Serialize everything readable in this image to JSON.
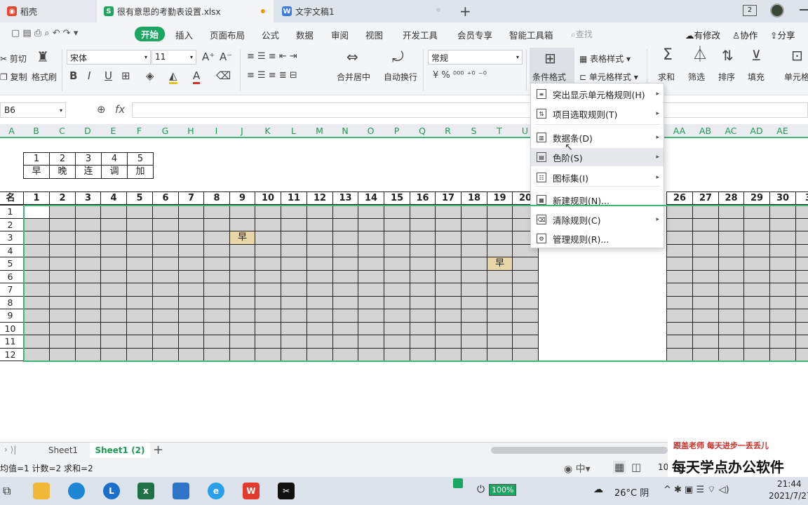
{
  "tabs": [
    {
      "label": "稻壳"
    },
    {
      "label": "很有意思的考勤表设置.xlsx"
    },
    {
      "label": "文字文稿1"
    }
  ],
  "window": {
    "badge": "2"
  },
  "menu": [
    "开始",
    "插入",
    "页面布局",
    "公式",
    "数据",
    "审阅",
    "视图",
    "开发工具",
    "会员专享",
    "智能工具箱"
  ],
  "menu_right": {
    "search": "查找",
    "modify": "有修改",
    "collab": "协作",
    "share": "分享"
  },
  "ribbon": {
    "cut": "剪切",
    "copy": "复制",
    "format_painter": "格式刷",
    "font_name": "宋体",
    "font_size": "11",
    "merge": "合并居中",
    "wrap": "自动换行",
    "number_format": "常规",
    "cond_format": "条件格式",
    "table_style": "表格样式",
    "cell_style": "单元格样式",
    "sum": "求和",
    "filter": "筛选",
    "sort": "排序",
    "fill": "填充",
    "cell_ops": "单元格"
  },
  "formula": {
    "name_box": "B6",
    "fx": "fx",
    "value": ""
  },
  "columns": [
    "A",
    "B",
    "C",
    "D",
    "E",
    "F",
    "G",
    "H",
    "I",
    "J",
    "K",
    "L",
    "M",
    "N",
    "O",
    "P",
    "Q",
    "R",
    "S",
    "T",
    "U",
    "AA",
    "AB",
    "AC",
    "AD",
    "AE"
  ],
  "legend": {
    "nums": [
      "1",
      "2",
      "3",
      "4",
      "5"
    ],
    "labels": [
      "早",
      "晚",
      "连",
      "调",
      "加"
    ]
  },
  "header_row": {
    "name": "名",
    "days": [
      "1",
      "2",
      "3",
      "4",
      "5",
      "6",
      "7",
      "8",
      "9",
      "10",
      "11",
      "12",
      "13",
      "14",
      "15",
      "16",
      "17",
      "18",
      "19",
      "20",
      "26",
      "27",
      "28",
      "29",
      "30",
      "3"
    ]
  },
  "rows": [
    "1",
    "2",
    "3",
    "4",
    "5",
    "6",
    "7",
    "8",
    "9",
    "10",
    "11",
    "12"
  ],
  "marks": [
    {
      "row": "3",
      "day": "9",
      "text": "早"
    },
    {
      "row": "5",
      "day": "19",
      "text": "早"
    }
  ],
  "dropdown": [
    {
      "label": "突出显示单元格规则(H)",
      "arrow": true
    },
    {
      "label": "项目选取规则(T)",
      "arrow": true
    },
    {
      "label": "数据条(D)",
      "arrow": true
    },
    {
      "label": "色阶(S)",
      "arrow": true
    },
    {
      "label": "图标集(I)",
      "arrow": true
    },
    {
      "label": "新建规则(N)...",
      "arrow": false
    },
    {
      "label": "清除规则(C)",
      "arrow": true
    },
    {
      "label": "管理规则(R)...",
      "arrow": false
    }
  ],
  "sheets": [
    "Sheet1",
    "Sheet1 (2)"
  ],
  "status": {
    "text": "均值=1  计数=2  求和=2",
    "zoom": "10"
  },
  "taskbar": {
    "battery": "100%",
    "weather": "26°C 阴",
    "time": "21:44",
    "date": "2021/7/27"
  },
  "watermark": {
    "line1": "跟盖老师  每天进步一丢丢儿",
    "line2": "每天学点办公软件"
  },
  "colors": {
    "accent": "#1aa560",
    "grid_fill": "#d4d4d4",
    "mark_fill": "#e8d5a8"
  }
}
